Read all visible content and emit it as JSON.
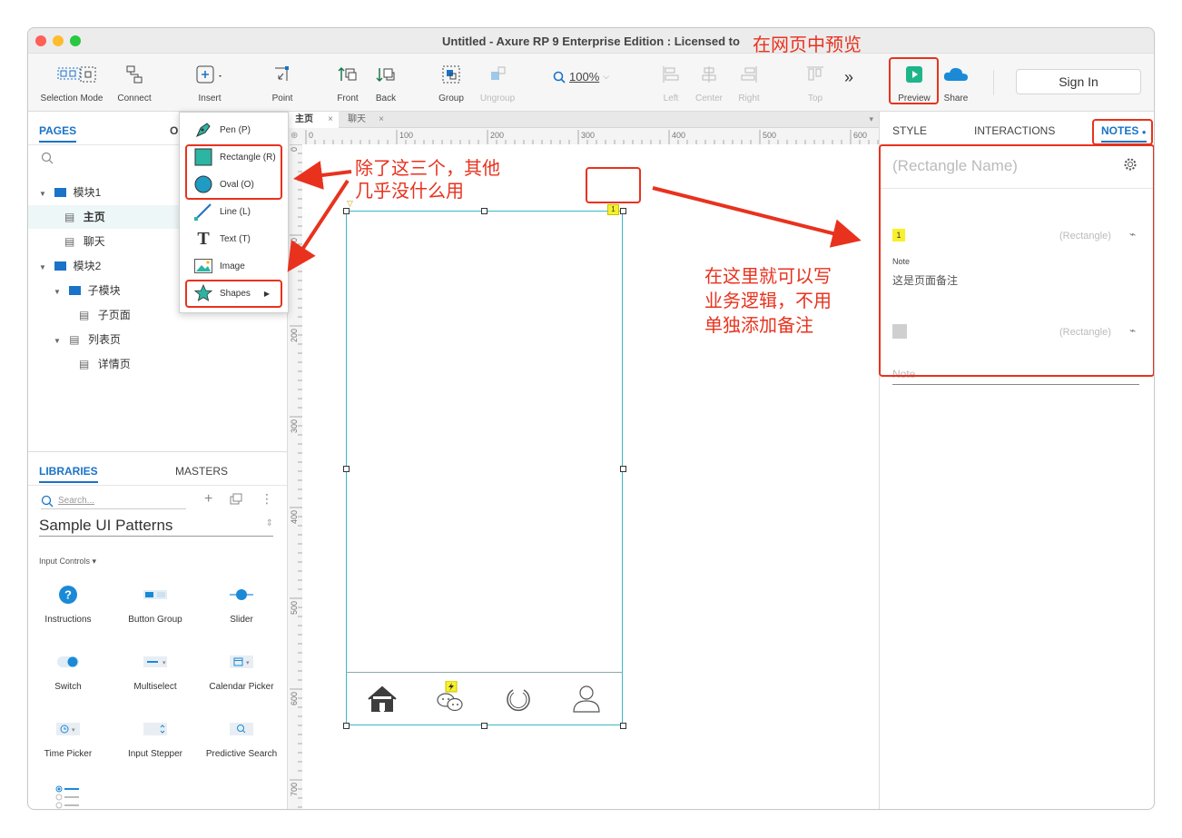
{
  "window": {
    "title": "Untitled - Axure RP 9 Enterprise Edition : Licensed to"
  },
  "toolbar": {
    "selection_mode": "Selection Mode",
    "connect": "Connect",
    "insert": "Insert",
    "point": "Point",
    "front": "Front",
    "back": "Back",
    "group": "Group",
    "ungroup": "Ungroup",
    "zoom": "100%",
    "left": "Left",
    "center": "Center",
    "right": "Right",
    "top": "Top",
    "more": "»",
    "preview": "Preview",
    "share": "Share",
    "sign_in": "Sign In"
  },
  "pages_panel": {
    "tab_pages": "PAGES",
    "tab_outline": "O",
    "items": [
      {
        "label": "模块1",
        "type": "folder"
      },
      {
        "label": "主页",
        "type": "page"
      },
      {
        "label": "聊天",
        "type": "page"
      },
      {
        "label": "模块2",
        "type": "folder"
      },
      {
        "label": "子模块",
        "type": "folder"
      },
      {
        "label": "子页面",
        "type": "page"
      },
      {
        "label": "列表页",
        "type": "page"
      },
      {
        "label": "详情页",
        "type": "page"
      }
    ]
  },
  "libraries_panel": {
    "tab_libraries": "LIBRARIES",
    "tab_masters": "MASTERS",
    "search_placeholder": "Search...",
    "library_name": "Sample UI Patterns",
    "section": "Input Controls ▾",
    "widgets": [
      {
        "label": "Instructions"
      },
      {
        "label": "Button Group"
      },
      {
        "label": "Slider"
      },
      {
        "label": "Switch"
      },
      {
        "label": "Multiselect"
      },
      {
        "label": "Calendar Picker"
      },
      {
        "label": "Time Picker"
      },
      {
        "label": "Input Stepper"
      },
      {
        "label": "Predictive Search"
      }
    ]
  },
  "insert_menu": {
    "items": [
      {
        "label": "Pen (P)"
      },
      {
        "label": "Rectangle (R)"
      },
      {
        "label": "Oval (O)"
      },
      {
        "label": "Line (L)"
      },
      {
        "label": "Text (T)"
      },
      {
        "label": "Image"
      },
      {
        "label": "Shapes"
      }
    ]
  },
  "canvas": {
    "tabs": [
      {
        "label": "主页"
      },
      {
        "label": "聊天"
      }
    ],
    "ruler_h": [
      "0",
      "100",
      "200",
      "300",
      "400",
      "500",
      "600"
    ],
    "ruler_v": [
      "0",
      "100",
      "200",
      "300",
      "400",
      "500",
      "600",
      "700"
    ],
    "note_marker": "1"
  },
  "right_panel": {
    "tab_style": "STYLE",
    "tab_interactions": "INTERACTIONS",
    "tab_notes": "NOTES",
    "name_placeholder": "(Rectangle Name)",
    "notes": [
      {
        "marker": "1",
        "type": "(Rectangle)",
        "field_label": "Note",
        "value": "这是页面备注"
      },
      {
        "marker": "",
        "type": "(Rectangle)",
        "field_placeholder": "Note"
      }
    ]
  },
  "annotations": {
    "preview_hint": "在网页中预览",
    "shapes_hint": "除了这三个，其他\n几乎没什么用",
    "notes_hint": "在这里就可以写\n业务逻辑，不用\n单独添加备注"
  },
  "colors": {
    "accent_blue": "#1a73c8",
    "annotation_red": "#e8321e",
    "selection_teal": "#37b9c6",
    "note_yellow": "#f7f02a",
    "preview_green": "#1fb58a"
  }
}
